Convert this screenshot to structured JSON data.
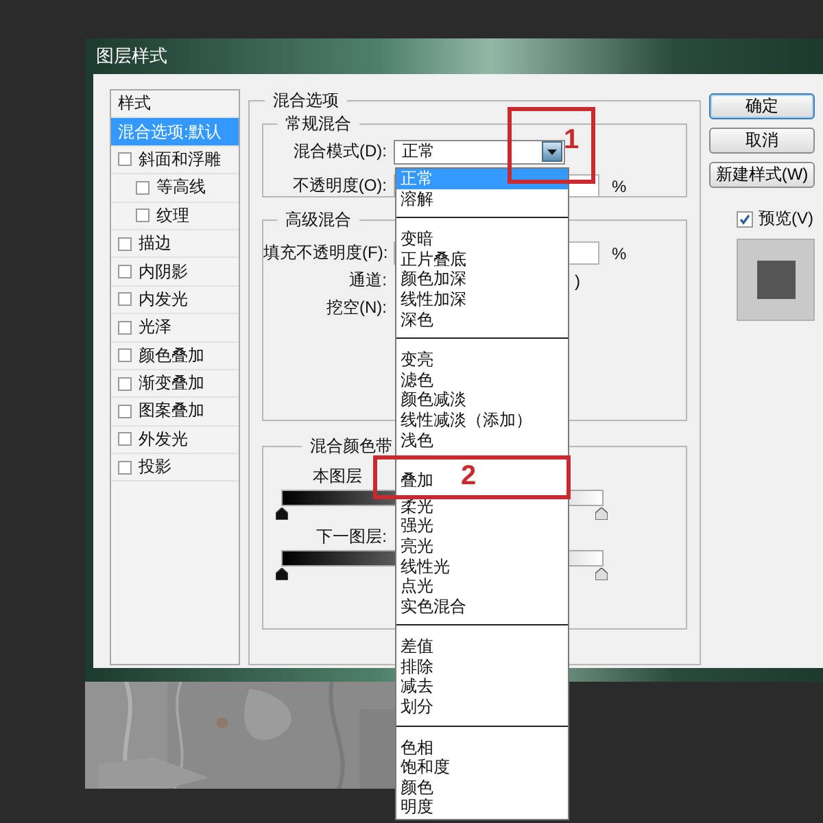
{
  "dialog": {
    "title": "图层样式"
  },
  "styles": [
    {
      "label": "样式",
      "kind": "header",
      "selected": false
    },
    {
      "label": "混合选项:默认",
      "kind": "option",
      "selected": true
    },
    {
      "label": "斜面和浮雕",
      "kind": "effect",
      "checked": false,
      "selected": false,
      "children": [
        {
          "label": "等高线",
          "kind": "effect",
          "checked": false,
          "selected": false
        },
        {
          "label": "纹理",
          "kind": "effect",
          "checked": false,
          "selected": false
        }
      ]
    },
    {
      "label": "描边",
      "kind": "effect",
      "checked": false,
      "selected": false
    },
    {
      "label": "内阴影",
      "kind": "effect",
      "checked": false,
      "selected": false
    },
    {
      "label": "内发光",
      "kind": "effect",
      "checked": false,
      "selected": false
    },
    {
      "label": "光泽",
      "kind": "effect",
      "checked": false,
      "selected": false
    },
    {
      "label": "颜色叠加",
      "kind": "effect",
      "checked": false,
      "selected": false
    },
    {
      "label": "渐变叠加",
      "kind": "effect",
      "checked": false,
      "selected": false
    },
    {
      "label": "图案叠加",
      "kind": "effect",
      "checked": false,
      "selected": false
    },
    {
      "label": "外发光",
      "kind": "effect",
      "checked": false,
      "selected": false
    },
    {
      "label": "投影",
      "kind": "effect",
      "checked": false,
      "selected": false
    }
  ],
  "blending": {
    "title": "混合选项",
    "general": {
      "title": "常规混合",
      "mode_label": "混合模式(D):",
      "mode_value": "正常",
      "opacity_label": "不透明度(O):",
      "opacity_unit": "%"
    },
    "advanced": {
      "title": "高级混合",
      "fill_label": "填充不透明度(F):",
      "fill_unit": "%",
      "channels_label": "通道:",
      "channels_tail": ")",
      "knockout_label": "挖空(N):"
    },
    "blend_if": {
      "title": "混合颜色带",
      "bars": [
        {
          "label": "本图层",
          "sliders": [
            {
              "level": 0
            },
            {
              "level": 1
            }
          ]
        },
        {
          "label": "下一图层:",
          "sliders": [
            {
              "level": 0
            },
            {
              "level": 1
            }
          ]
        }
      ]
    }
  },
  "buttons": [
    {
      "label": "确定",
      "default": true
    },
    {
      "label": "取消",
      "default": false
    },
    {
      "label": "新建样式(W)",
      "default": false
    }
  ],
  "preview": {
    "label": "预览(V)",
    "checked": true
  },
  "mode_menu": [
    [
      {
        "label": "正常",
        "selected": true
      },
      {
        "label": "溶解",
        "selected": false
      }
    ],
    [
      {
        "label": "变暗",
        "selected": false
      },
      {
        "label": "正片叠底",
        "selected": false
      },
      {
        "label": "颜色加深",
        "selected": false
      },
      {
        "label": "线性加深",
        "selected": false
      },
      {
        "label": "深色",
        "selected": false
      }
    ],
    [
      {
        "label": "变亮",
        "selected": false
      },
      {
        "label": "滤色",
        "selected": false
      },
      {
        "label": "颜色减淡",
        "selected": false
      },
      {
        "label": "线性减淡（添加）",
        "selected": false
      },
      {
        "label": "浅色",
        "selected": false
      }
    ],
    [
      {
        "label": "叠加",
        "selected": false
      },
      {
        "label": "柔光",
        "selected": false
      },
      {
        "label": "强光",
        "selected": false
      },
      {
        "label": "亮光",
        "selected": false
      },
      {
        "label": "线性光",
        "selected": false
      },
      {
        "label": "点光",
        "selected": false
      },
      {
        "label": "实色混合",
        "selected": false
      }
    ],
    [
      {
        "label": "差值",
        "selected": false
      },
      {
        "label": "排除",
        "selected": false
      },
      {
        "label": "减去",
        "selected": false
      },
      {
        "label": "划分",
        "selected": false
      }
    ],
    [
      {
        "label": "色相",
        "selected": false
      },
      {
        "label": "饱和度",
        "selected": false
      },
      {
        "label": "颜色",
        "selected": false
      },
      {
        "label": "明度",
        "selected": false
      }
    ]
  ],
  "annotations": [
    {
      "label": "1"
    },
    {
      "label": "2"
    }
  ]
}
